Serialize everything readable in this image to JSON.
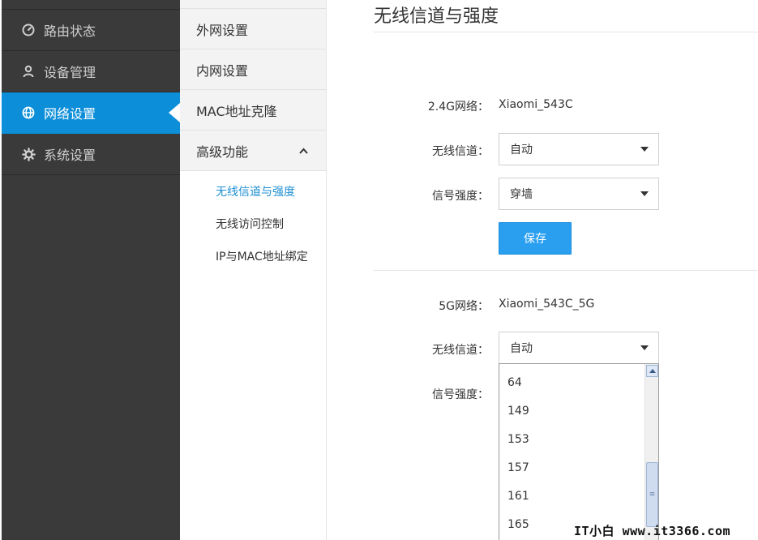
{
  "sidebar": {
    "items": [
      {
        "label": "路由状态",
        "icon": "gauge-icon"
      },
      {
        "label": "设备管理",
        "icon": "user-icon"
      },
      {
        "label": "网络设置",
        "icon": "globe-icon",
        "active": true
      },
      {
        "label": "系统设置",
        "icon": "gear-icon"
      }
    ]
  },
  "submenu": {
    "items": [
      "外网设置",
      "内网设置",
      "MAC地址克隆",
      "高级功能"
    ],
    "advanced_children": [
      {
        "label": "无线信道与强度",
        "active": true
      },
      {
        "label": "无线访问控制"
      },
      {
        "label": "IP与MAC地址绑定"
      }
    ],
    "expanded_icon": "chevron-up-icon"
  },
  "main": {
    "title": "无线信道与强度",
    "section_24g": {
      "network_label": "2.4G网络：",
      "network_name": "Xiaomi_543C",
      "channel_label": "无线信道：",
      "channel_value": "自动",
      "strength_label": "信号强度：",
      "strength_value": "穿墙",
      "save_label": "保存"
    },
    "section_5g": {
      "network_label": "5G网络：",
      "network_name": "Xiaomi_543C_5G",
      "channel_label": "无线信道：",
      "channel_value": "自动",
      "strength_label": "信号强度："
    },
    "channel_options": [
      "64",
      "149",
      "153",
      "157",
      "161",
      "165"
    ]
  },
  "colors": {
    "sidebar_bg": "#3a3a3a",
    "active_blue": "#0c8ed9",
    "button_blue": "#2a9ff0",
    "link_blue": "#1e8fd4"
  },
  "watermark": "IT小白  www.it3366.com"
}
